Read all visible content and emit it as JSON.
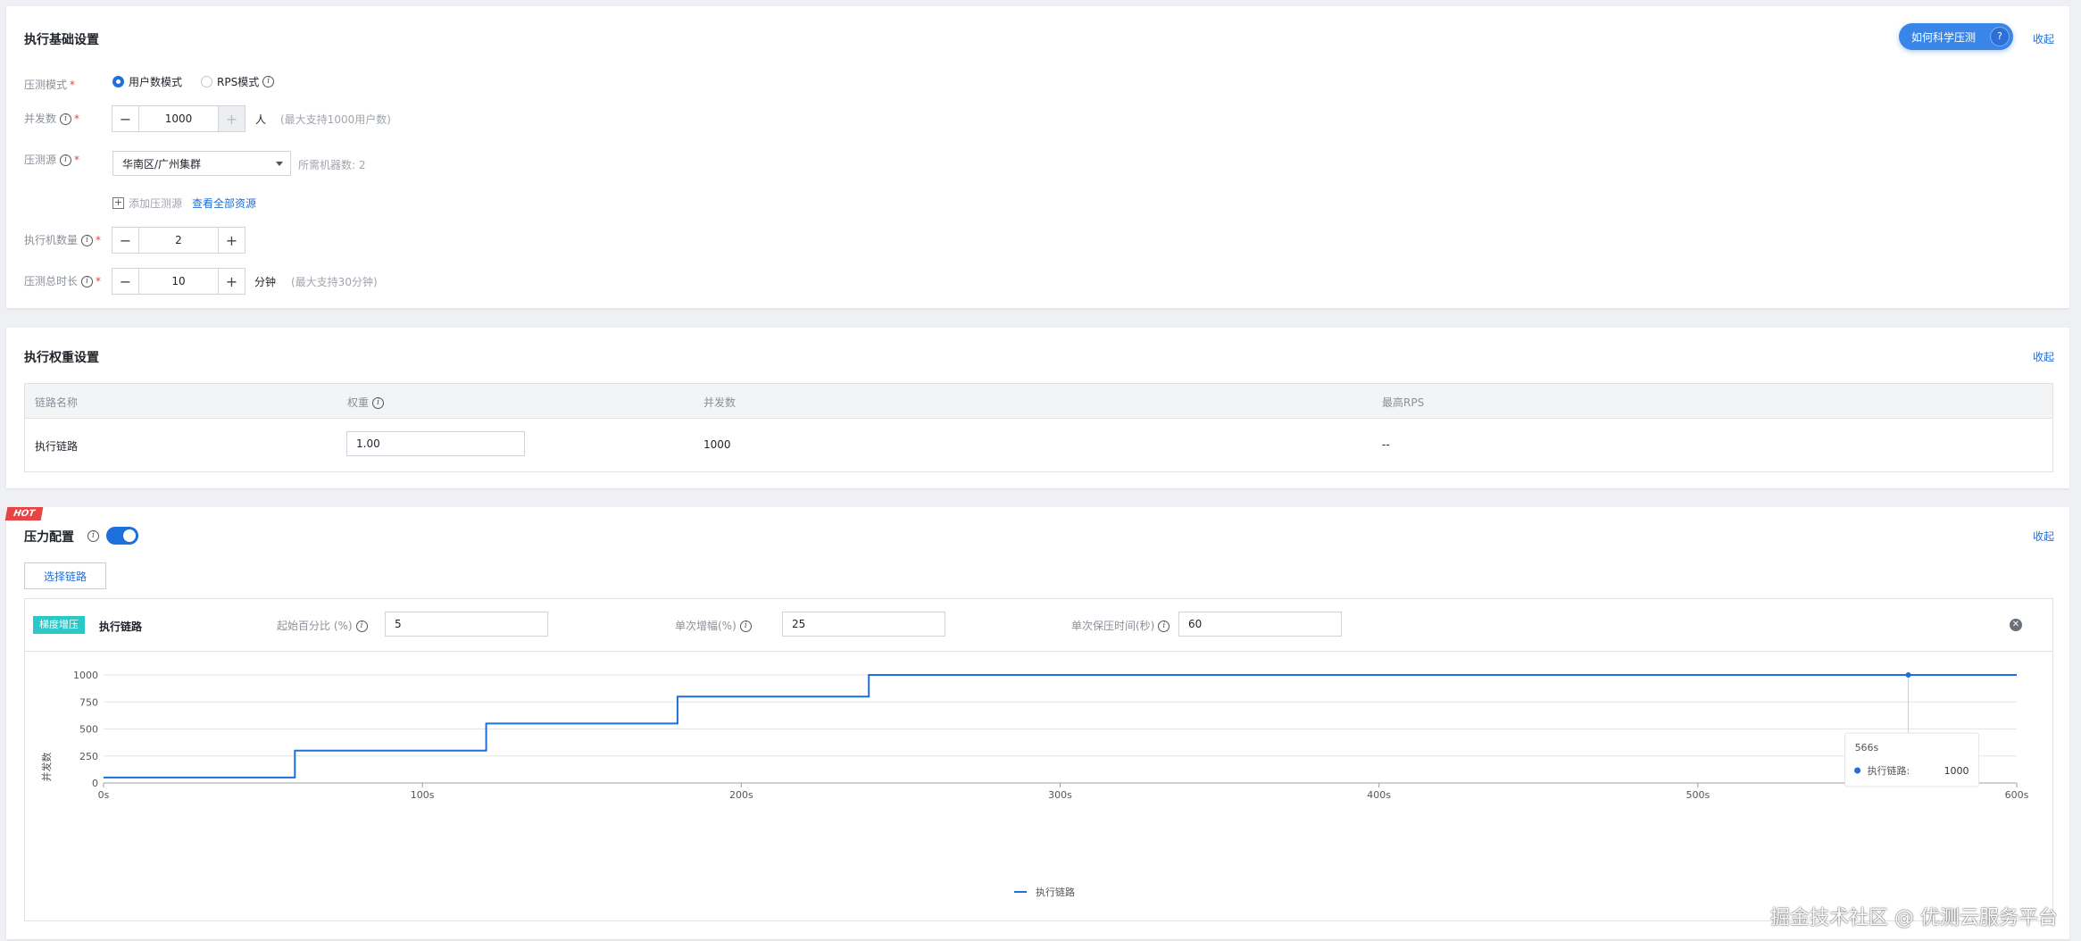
{
  "basic": {
    "title": "执行基础设置",
    "help_pill": "如何科学压测",
    "collapse": "收起",
    "mode_label": "压测模式",
    "mode_user": "用户数模式",
    "mode_rps": "RPS模式",
    "concurrency_label": "并发数",
    "concurrency_value": "1000",
    "concurrency_unit": "人",
    "concurrency_hint": "(最大支持1000用户数)",
    "source_label": "压测源",
    "source_value": "华南区/广州集群",
    "machines_needed": "所需机器数: 2",
    "add_source": "添加压测源",
    "view_all": "查看全部资源",
    "machine_count_label": "执行机数量",
    "machine_count_value": "2",
    "duration_label": "压测总时长",
    "duration_value": "10",
    "duration_unit": "分钟",
    "duration_hint": "(最大支持30分钟)"
  },
  "weight": {
    "title": "执行权重设置",
    "collapse": "收起",
    "columns": [
      "链路名称",
      "权重",
      "并发数",
      "最高RPS"
    ],
    "row": {
      "name": "执行链路",
      "weight": "1.00",
      "concurrency": "1000",
      "max_rps": "--"
    }
  },
  "pressure": {
    "hot_badge": "HOT",
    "title": "压力配置",
    "collapse": "收起",
    "toggle_on": true,
    "select_chain": "选择链路",
    "tag": "梯度增压",
    "chain_name": "执行链路",
    "start_pct_label": "起始百分比 (%)",
    "start_pct_value": "5",
    "step_pct_label": "单次增幅(%)",
    "step_pct_value": "25",
    "hold_label": "单次保压时间(秒)",
    "hold_value": "60"
  },
  "chart_data": {
    "type": "line",
    "ylabel": "并发数",
    "ylim": [
      0,
      1000
    ],
    "yticks": [
      "0",
      "250",
      "500",
      "750",
      "1000"
    ],
    "xlim": [
      0,
      600
    ],
    "xticks": [
      "0s",
      "100s",
      "200s",
      "300s",
      "400s",
      "500s",
      "600s"
    ],
    "series": [
      {
        "name": "执行链路",
        "color": "#1d6fdc",
        "x": [
          0,
          60,
          60,
          120,
          120,
          180,
          180,
          240,
          240,
          600
        ],
        "y": [
          50,
          50,
          300,
          300,
          550,
          550,
          800,
          800,
          1000,
          1000
        ]
      }
    ],
    "tooltip": {
      "x_label": "566s",
      "series_label": "执行链路:",
      "value": "1000",
      "x": 566
    },
    "legend_position": "bottom"
  },
  "watermark": "掘金技术社区 @ 优测云服务平台"
}
